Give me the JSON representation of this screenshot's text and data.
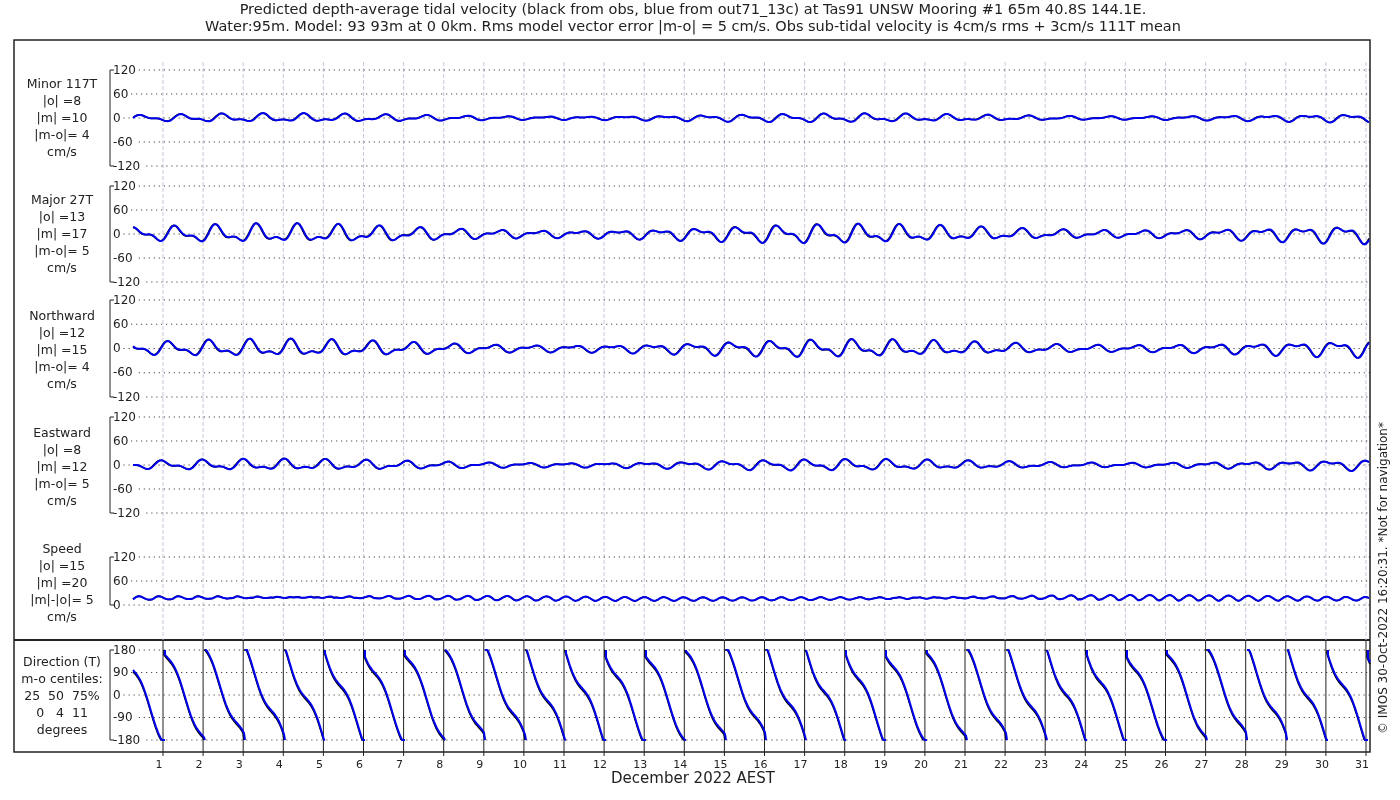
{
  "title_lines": [
    "Predicted depth-average tidal velocity (black from obs, blue from out71_13c) at Tas91 UNSW Mooring #1 65m 40.8S 144.1E.",
    "Water:95m. Model: 93 93m at 0 0km. Rms model vector error |m-o| = 5 cm/s. Obs sub-tidal velocity is 4cm/s rms + 3cm/s 111T mean"
  ],
  "panels": [
    {
      "kind": "velocity",
      "label_lines": [
        "Minor 117T",
        "|o| =8",
        "|m| =10",
        "|m-o|= 4",
        "cm/s"
      ],
      "y_ticks": [
        "120",
        "60",
        "0",
        "-60",
        "-120"
      ]
    },
    {
      "kind": "velocity",
      "label_lines": [
        "Major 27T",
        "|o| =13",
        "|m| =17",
        "|m-o|= 5",
        "cm/s"
      ],
      "y_ticks": [
        "120",
        "60",
        "0",
        "-60",
        "-120"
      ]
    },
    {
      "kind": "velocity",
      "label_lines": [
        "Northward",
        "|o| =12",
        "|m| =15",
        "|m-o|= 4",
        "cm/s"
      ],
      "y_ticks": [
        "120",
        "60",
        "0",
        "-60",
        "-120"
      ]
    },
    {
      "kind": "velocity",
      "label_lines": [
        "Eastward",
        "|o| =8",
        "|m| =12",
        "|m-o|= 5",
        "cm/s"
      ],
      "y_ticks": [
        "120",
        "60",
        "0",
        "-60",
        "-120"
      ]
    },
    {
      "kind": "speed",
      "label_lines": [
        "Speed",
        "|o| =15",
        "|m| =20",
        "|m|-|o|= 5",
        "cm/s"
      ],
      "y_ticks": [
        "120",
        "60",
        "0"
      ]
    },
    {
      "kind": "direction",
      "label_lines": [
        "Direction (T)",
        "m-o centiles:",
        "25  50  75%",
        "0   4  11",
        "degrees"
      ],
      "y_ticks": [
        "180",
        "90",
        "0",
        "-90",
        "-180"
      ]
    }
  ],
  "x_ticks": [
    "1",
    "2",
    "3",
    "4",
    "5",
    "6",
    "7",
    "8",
    "9",
    "10",
    "11",
    "12",
    "13",
    "14",
    "15",
    "16",
    "17",
    "18",
    "19",
    "20",
    "21",
    "22",
    "23",
    "24",
    "25",
    "26",
    "27",
    "28",
    "29",
    "30",
    "31"
  ],
  "x_label": "December 2022 AEST",
  "footer": "© IMOS 30-Oct-2022 16:20:31. *Not for navigation*"
}
